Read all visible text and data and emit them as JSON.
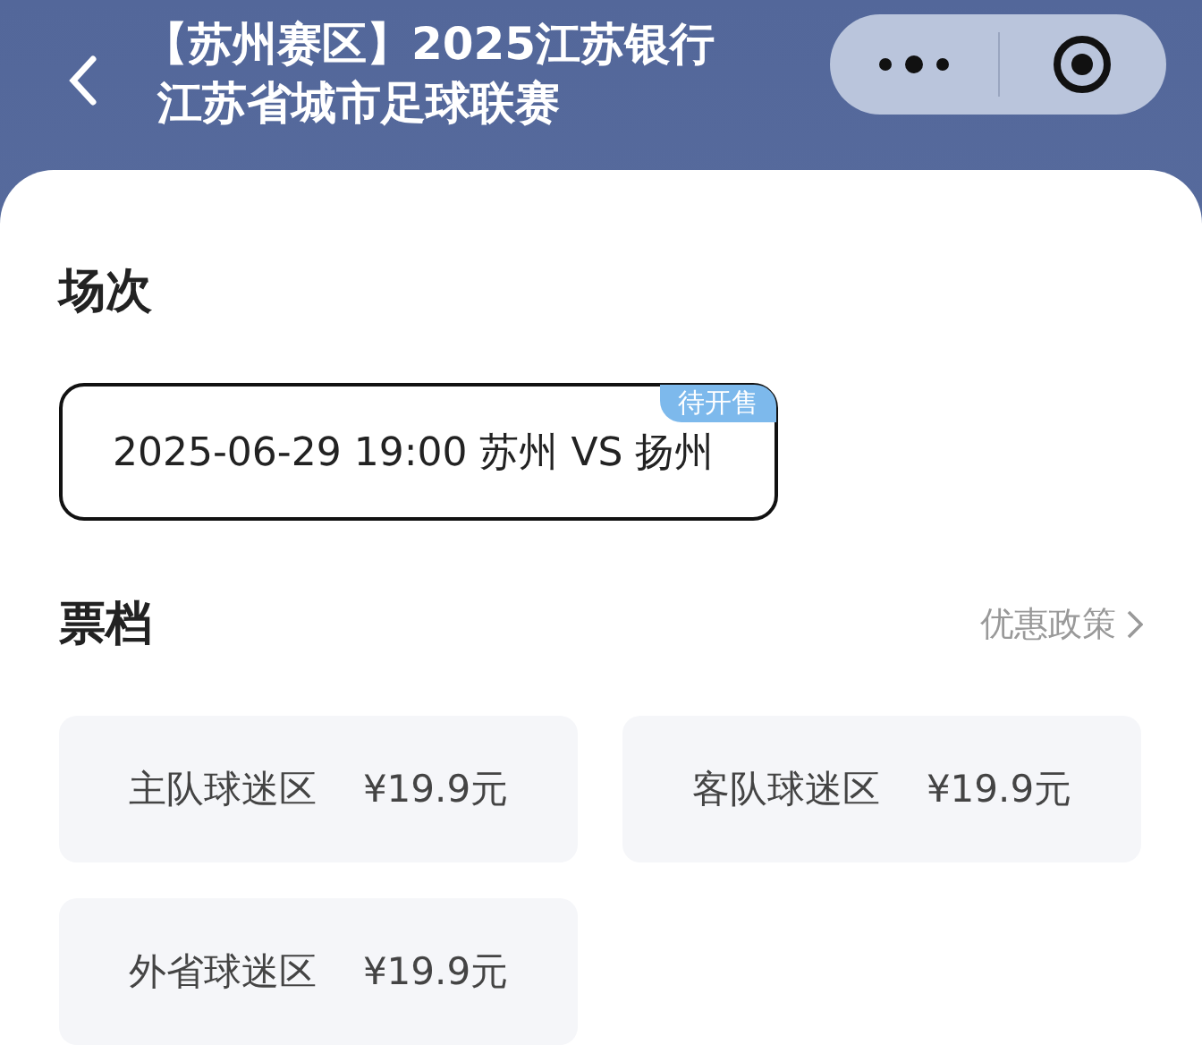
{
  "header": {
    "title_lines": [
      "【苏州赛区】2025江苏银行",
      "江苏省城市足球联赛"
    ]
  },
  "sessions": {
    "title": "场次",
    "items": [
      {
        "label": "2025-06-29 19:00 苏州 VS 扬州",
        "badge": "待开售",
        "selected": true
      }
    ]
  },
  "tickets": {
    "title": "票档",
    "link": "优惠政策",
    "items": [
      {
        "name": "主队球迷区",
        "price": "¥19.9元"
      },
      {
        "name": "客队球迷区",
        "price": "¥19.9元"
      },
      {
        "name": "外省球迷区",
        "price": "¥19.9元"
      }
    ]
  }
}
